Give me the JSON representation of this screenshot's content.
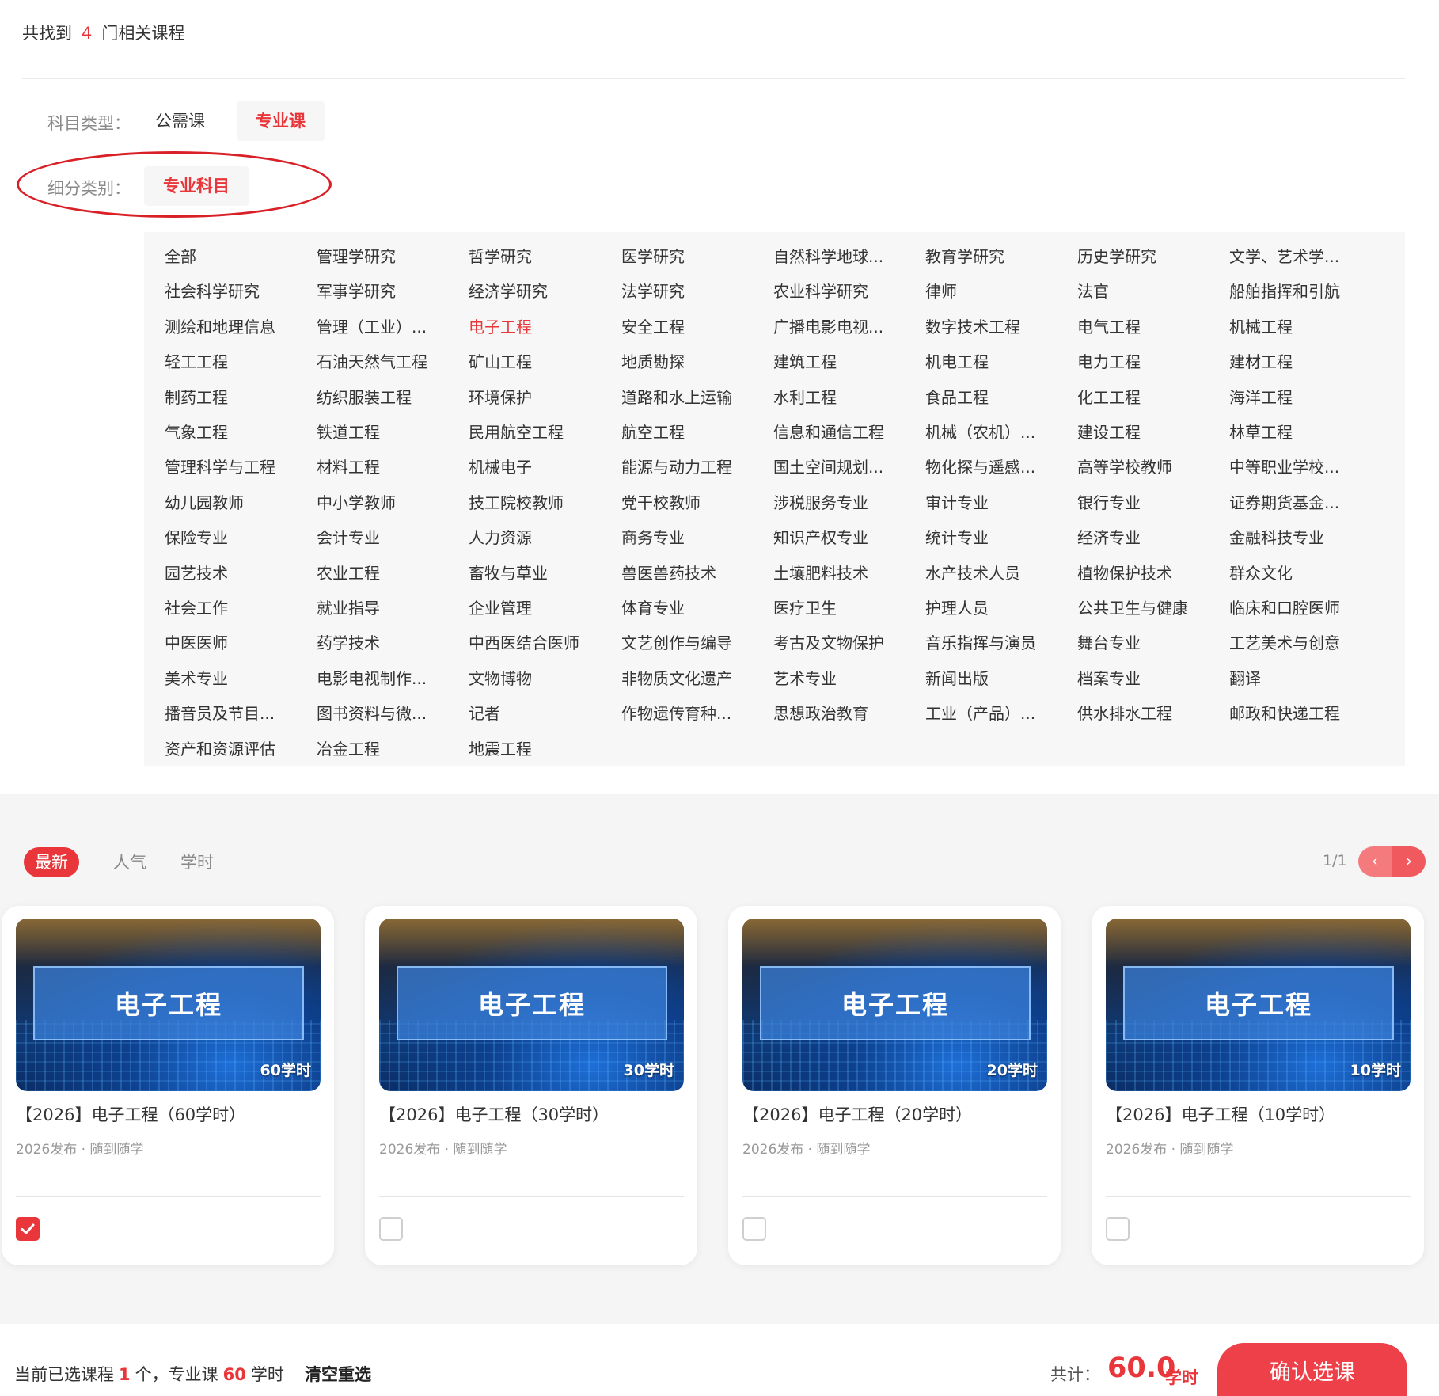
{
  "results": {
    "prefix": "共找到",
    "count": "4",
    "suffix": "门相关课程"
  },
  "filters": {
    "subject_type": {
      "label": "科目类型：",
      "options": [
        "公需课",
        "专业课"
      ],
      "selected": "专业课"
    },
    "sub_category": {
      "label": "细分类别：",
      "options": [
        "专业科目"
      ],
      "selected": "专业科目"
    }
  },
  "subjects": {
    "selected": "电子工程",
    "items": [
      "全部",
      "管理学研究",
      "哲学研究",
      "医学研究",
      "自然科学地球...",
      "教育学研究",
      "历史学研究",
      "文学、艺术学...",
      "社会科学研究",
      "军事学研究",
      "经济学研究",
      "法学研究",
      "农业科学研究",
      "律师",
      "法官",
      "船舶指挥和引航",
      "测绘和地理信息",
      "管理（工业）...",
      "电子工程",
      "安全工程",
      "广播电影电视...",
      "数字技术工程",
      "电气工程",
      "机械工程",
      "轻工工程",
      "石油天然气工程",
      "矿山工程",
      "地质勘探",
      "建筑工程",
      "机电工程",
      "电力工程",
      "建材工程",
      "制药工程",
      "纺织服装工程",
      "环境保护",
      "道路和水上运输",
      "水利工程",
      "食品工程",
      "化工工程",
      "海洋工程",
      "气象工程",
      "铁道工程",
      "民用航空工程",
      "航空工程",
      "信息和通信工程",
      "机械（农机）...",
      "建设工程",
      "林草工程",
      "管理科学与工程",
      "材料工程",
      "机械电子",
      "能源与动力工程",
      "国土空间规划...",
      "物化探与遥感...",
      "高等学校教师",
      "中等职业学校...",
      "幼儿园教师",
      "中小学教师",
      "技工院校教师",
      "党干校教师",
      "涉税服务专业",
      "审计专业",
      "银行专业",
      "证券期货基金...",
      "保险专业",
      "会计专业",
      "人力资源",
      "商务专业",
      "知识产权专业",
      "统计专业",
      "经济专业",
      "金融科技专业",
      "园艺技术",
      "农业工程",
      "畜牧与草业",
      "兽医兽药技术",
      "土壤肥料技术",
      "水产技术人员",
      "植物保护技术",
      "群众文化",
      "社会工作",
      "就业指导",
      "企业管理",
      "体育专业",
      "医疗卫生",
      "护理人员",
      "公共卫生与健康",
      "临床和口腔医师",
      "中医医师",
      "药学技术",
      "中西医结合医师",
      "文艺创作与编导",
      "考古及文物保护",
      "音乐指挥与演员",
      "舞台专业",
      "工艺美术与创意",
      "美术专业",
      "电影电视制作...",
      "文物博物",
      "非物质文化遗产",
      "艺术专业",
      "新闻出版",
      "档案专业",
      "翻译",
      "播音员及节目...",
      "图书资料与微...",
      "记者",
      "作物遗传育种...",
      "思想政治教育",
      "工业（产品）...",
      "供水排水工程",
      "邮政和快递工程",
      "资产和资源评估",
      "冶金工程",
      "地震工程"
    ]
  },
  "sort": {
    "tabs": [
      "最新",
      "人气",
      "学时"
    ],
    "active": "最新"
  },
  "pager": {
    "text": "1/1",
    "prev": "‹",
    "next": "›"
  },
  "courses": [
    {
      "thumb_title": "电子工程",
      "hours_badge": "60学时",
      "title": "【2026】电子工程（60学时）",
      "meta": "2026发布 · 随到随学",
      "checked": true
    },
    {
      "thumb_title": "电子工程",
      "hours_badge": "30学时",
      "title": "【2026】电子工程（30学时）",
      "meta": "2026发布 · 随到随学",
      "checked": false
    },
    {
      "thumb_title": "电子工程",
      "hours_badge": "20学时",
      "title": "【2026】电子工程（20学时）",
      "meta": "2026发布 · 随到随学",
      "checked": false
    },
    {
      "thumb_title": "电子工程",
      "hours_badge": "10学时",
      "title": "【2026】电子工程（10学时）",
      "meta": "2026发布 · 随到随学",
      "checked": false
    }
  ],
  "footer": {
    "sel_prefix": "当前已选课程",
    "sel_count": "1",
    "sel_mid": "个，专业课",
    "sel_hours": "60",
    "sel_suffix": "学时",
    "clear": "清空重选",
    "total_label": "共计：",
    "total_value": "60.0",
    "total_unit": "学时",
    "confirm": "确认选课"
  },
  "colors": {
    "accent": "#e8363a",
    "annotation": "#d92027",
    "panel": "#f7f7f7"
  },
  "icons": {
    "prev": "chevron-left-icon",
    "next": "chevron-right-icon",
    "check": "checkmark-icon"
  }
}
